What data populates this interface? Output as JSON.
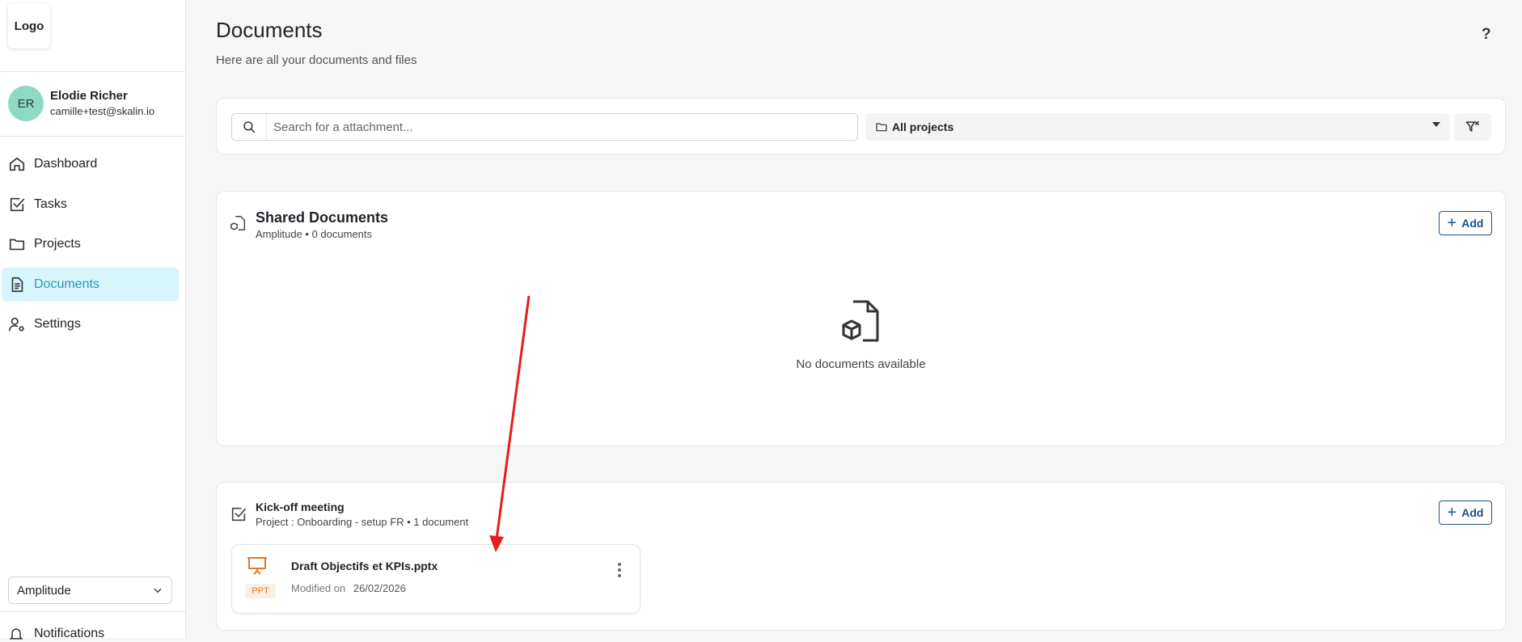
{
  "sidebar": {
    "logo": "Logo",
    "user": {
      "initials": "ER",
      "name": "Elodie Richer",
      "email": "camille+test@skalin.io"
    },
    "nav": [
      {
        "label": "Dashboard",
        "icon": "home-icon"
      },
      {
        "label": "Tasks",
        "icon": "checkbox-icon"
      },
      {
        "label": "Projects",
        "icon": "folder-icon"
      },
      {
        "label": "Documents",
        "icon": "document-icon",
        "active": true
      },
      {
        "label": "Settings",
        "icon": "user-gear-icon"
      }
    ],
    "workspace": "Amplitude",
    "notifications": "Notifications"
  },
  "header": {
    "title": "Documents",
    "subtitle": "Here are all your documents and files",
    "help": "?"
  },
  "filters": {
    "search_placeholder": "Search for a attachment...",
    "project_select": "All projects"
  },
  "shared": {
    "title": "Shared Documents",
    "subtitle": "Amplitude • 0 documents",
    "add_label": "Add",
    "empty_text": "No documents available"
  },
  "kickoff": {
    "title": "Kick-off meeting",
    "subtitle": "Project : Onboarding - setup FR • 1 document",
    "add_label": "Add",
    "documents": [
      {
        "name": "Draft Objectifs et KPIs.pptx",
        "type_badge": "PPT",
        "modified_label": "Modified on",
        "modified_date": "26/02/2026"
      }
    ]
  },
  "colors": {
    "accent_active_bg": "#d7f6fb",
    "accent_active_text": "#2a97b2",
    "primary_button": "#1d4f8c",
    "ppt_orange": "#e07a26",
    "annotation_arrow": "#e81c1c"
  }
}
